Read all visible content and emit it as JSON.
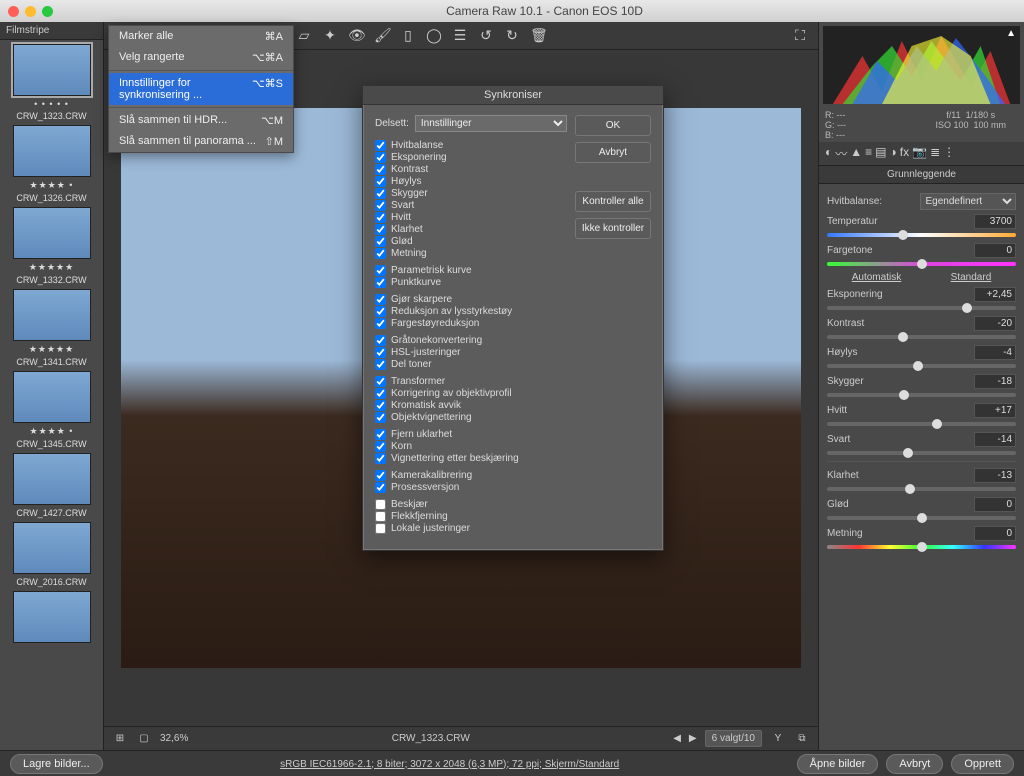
{
  "title": "Camera Raw 10.1  -  Canon EOS 10D",
  "filmstrip": {
    "header": "Filmstripe",
    "items": [
      {
        "name": "CRW_1323.CRW",
        "stars": "• • • • •",
        "sel": true
      },
      {
        "name": "CRW_1326.CRW",
        "stars": "★★★★ •"
      },
      {
        "name": "CRW_1332.CRW",
        "stars": "★★★★★"
      },
      {
        "name": "CRW_1341.CRW",
        "stars": "★★★★★"
      },
      {
        "name": "CRW_1345.CRW",
        "stars": "★★★★ •"
      },
      {
        "name": "CRW_1427.CRW",
        "stars": ""
      },
      {
        "name": "CRW_2016.CRW",
        "stars": ""
      },
      {
        "name": "",
        "stars": ""
      }
    ]
  },
  "context_menu": {
    "items": [
      {
        "label": "Marker alle",
        "shortcut": "⌘A"
      },
      {
        "label": "Velg rangerte",
        "shortcut": "⌥⌘A"
      },
      {
        "label": "Innstillinger for synkronisering ...",
        "shortcut": "⌥⌘S",
        "sel": true
      },
      {
        "label": "Slå sammen til HDR...",
        "shortcut": "⌥M"
      },
      {
        "label": "Slå sammen til panorama ...",
        "shortcut": "⇧M"
      }
    ]
  },
  "dialog": {
    "title": "Synkroniser",
    "subset_label": "Delsett:",
    "subset_value": "Innstillinger",
    "buttons": {
      "ok": "OK",
      "cancel": "Avbryt",
      "checkall": "Kontroller alle",
      "uncheckall": "Ikke kontroller"
    },
    "groups": [
      [
        {
          "l": "Hvitbalanse",
          "c": true
        },
        {
          "l": "Eksponering",
          "c": true
        },
        {
          "l": "Kontrast",
          "c": true
        },
        {
          "l": "Høylys",
          "c": true
        },
        {
          "l": "Skygger",
          "c": true
        },
        {
          "l": "Svart",
          "c": true
        },
        {
          "l": "Hvitt",
          "c": true
        },
        {
          "l": "Klarhet",
          "c": true
        },
        {
          "l": "Glød",
          "c": true
        },
        {
          "l": "Metning",
          "c": true
        }
      ],
      [
        {
          "l": "Parametrisk kurve",
          "c": true
        },
        {
          "l": "Punktkurve",
          "c": true
        }
      ],
      [
        {
          "l": "Gjør skarpere",
          "c": true
        },
        {
          "l": "Reduksjon av lysstyrkestøy",
          "c": true
        },
        {
          "l": "Fargestøyreduksjon",
          "c": true
        }
      ],
      [
        {
          "l": "Gråtonekonvertering",
          "c": true
        },
        {
          "l": "HSL-justeringer",
          "c": true
        },
        {
          "l": "Del toner",
          "c": true
        }
      ],
      [
        {
          "l": "Transformer",
          "c": true
        },
        {
          "l": "Korrigering av objektivprofil",
          "c": true
        },
        {
          "l": "Kromatisk avvik",
          "c": true
        },
        {
          "l": "Objektvignettering",
          "c": true
        }
      ],
      [
        {
          "l": "Fjern uklarhet",
          "c": true
        },
        {
          "l": "Korn",
          "c": true
        },
        {
          "l": "Vignettering etter beskjæring",
          "c": true
        }
      ],
      [
        {
          "l": "Kamerakalibrering",
          "c": true
        },
        {
          "l": "Prosessversjon",
          "c": true
        }
      ],
      [
        {
          "l": "Beskjær",
          "c": false
        },
        {
          "l": "Flekkfjerning",
          "c": false
        },
        {
          "l": "Lokale justeringer",
          "c": false
        }
      ]
    ]
  },
  "status": {
    "zoom": "32,6%",
    "filename": "CRW_1323.CRW",
    "nav": "6 valgt/10"
  },
  "readout": {
    "r": "R:   ---",
    "g": "G:   ---",
    "b": "B:   ---",
    "aperture": "f/11",
    "shutter": "1/180 s",
    "iso": "ISO 100",
    "lens": "100 mm"
  },
  "panel": {
    "title": "Grunnleggende",
    "wb_label": "Hvitbalanse:",
    "wb_value": "Egendefinert",
    "temp_label": "Temperatur",
    "temp_value": "3700",
    "tint_label": "Fargetone",
    "tint_value": "0",
    "auto": "Automatisk",
    "standard": "Standard",
    "sliders": [
      {
        "l": "Eksponering",
        "v": "+2,45",
        "p": 74
      },
      {
        "l": "Kontrast",
        "v": "-20",
        "p": 40
      },
      {
        "l": "Høylys",
        "v": "-4",
        "p": 48
      },
      {
        "l": "Skygger",
        "v": "-18",
        "p": 41
      },
      {
        "l": "Hvitt",
        "v": "+17",
        "p": 58
      },
      {
        "l": "Svart",
        "v": "-14",
        "p": 43
      }
    ],
    "sliders2": [
      {
        "l": "Klarhet",
        "v": "-13",
        "p": 44
      },
      {
        "l": "Glød",
        "v": "0",
        "p": 50
      },
      {
        "l": "Metning",
        "v": "0",
        "p": 50
      }
    ]
  },
  "footer": {
    "save": "Lagre bilder...",
    "info": "sRGB IEC61966-2.1; 8 biter; 3072 x 2048 (6,3 MP); 72 ppi; Skjerm/Standard",
    "open": "Åpne bilder",
    "cancel": "Avbryt",
    "done": "Opprett"
  }
}
